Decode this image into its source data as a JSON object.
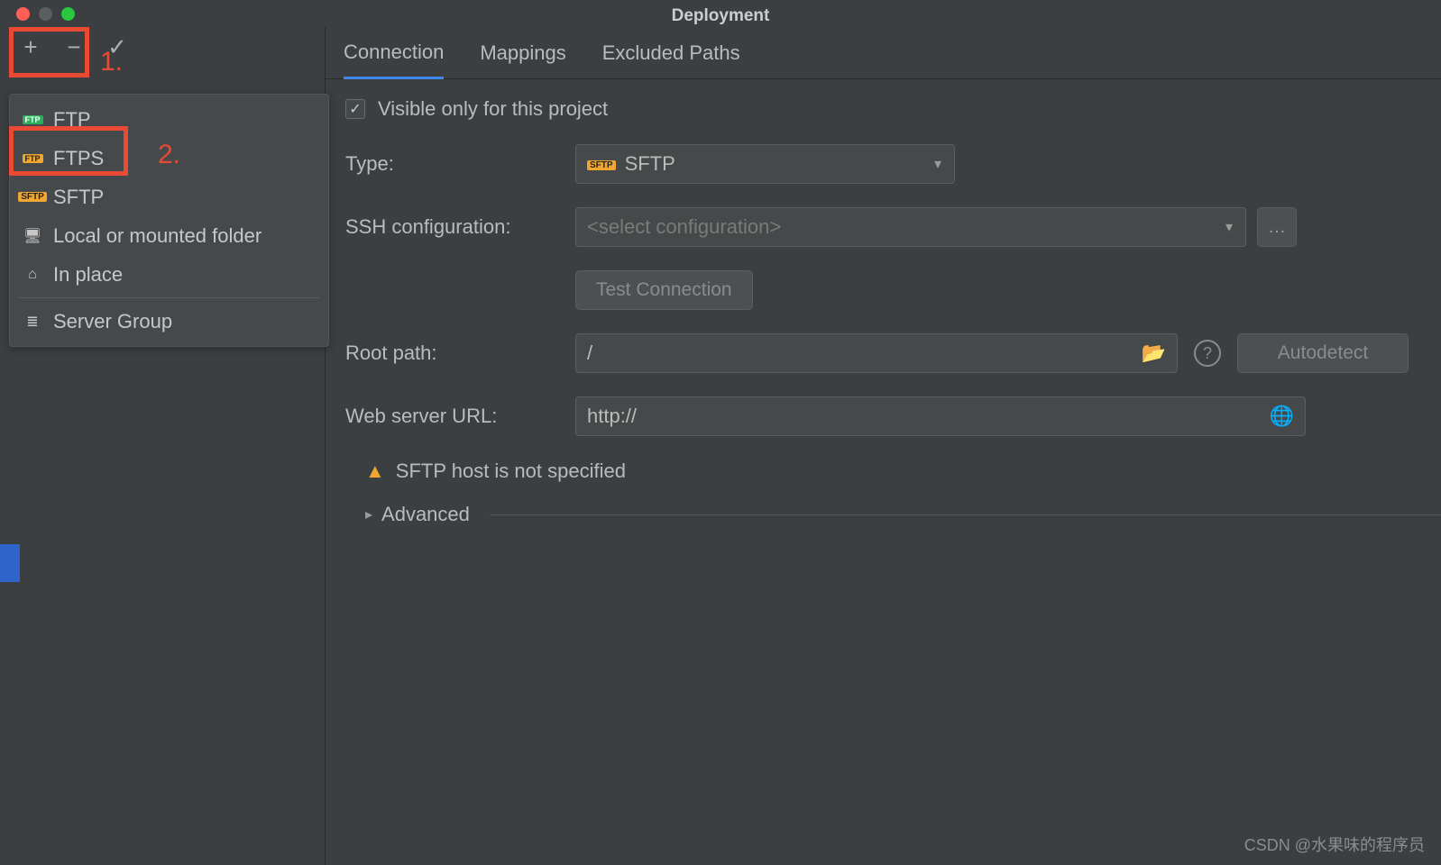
{
  "window": {
    "title": "Deployment"
  },
  "annotations": {
    "label1": "1.",
    "label2": "2."
  },
  "toolbar": {
    "add_tip": "+",
    "remove_tip": "−",
    "apply_tip": "✓"
  },
  "menu": {
    "items": [
      {
        "label": "FTP",
        "icon": "ftp-icon"
      },
      {
        "label": "FTPS",
        "icon": "ftps-icon"
      },
      {
        "label": "SFTP",
        "icon": "sftp-icon"
      },
      {
        "label": "Local or mounted folder",
        "icon": "folder-icon"
      },
      {
        "label": "In place",
        "icon": "home-icon"
      }
    ],
    "group_label": "Server Group"
  },
  "tabs": {
    "connection": "Connection",
    "mappings": "Mappings",
    "excluded": "Excluded Paths"
  },
  "form": {
    "visible_checkbox_label": "Visible only for this project",
    "visible_checked": true,
    "type_label": "Type:",
    "type_value": "SFTP",
    "ssh_label": "SSH configuration:",
    "ssh_placeholder": "<select configuration>",
    "test_button": "Test Connection",
    "root_label": "Root path:",
    "root_value": "/",
    "autodetect_button": "Autodetect",
    "web_label": "Web server URL:",
    "web_value": "http://",
    "warning": "SFTP host is not specified",
    "advanced_label": "Advanced"
  },
  "watermark": "CSDN @水果味的程序员"
}
